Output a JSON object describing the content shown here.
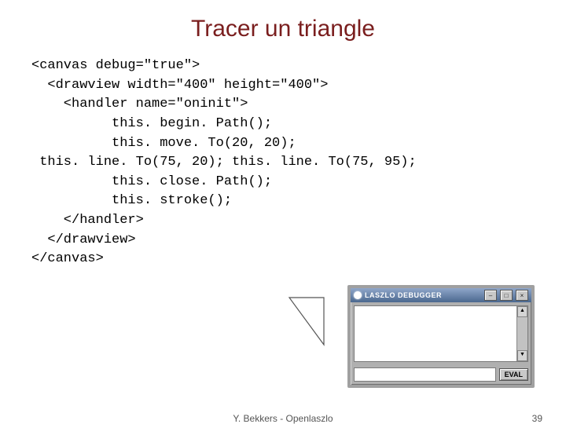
{
  "title": "Tracer un triangle",
  "code": {
    "l1": "<canvas debug=\"true\">",
    "l2": "  <drawview width=\"400\" height=\"400\">",
    "l3": "    <handler name=\"oninit\">",
    "l4": "          this. begin. Path();",
    "l5": "          this. move. To(20, 20);",
    "l6": " this. line. To(75, 20); this. line. To(75, 95);",
    "l7": "          this. close. Path();",
    "l8": "          this. stroke();",
    "l9": "    </handler>",
    "l10": "  </drawview>",
    "l11": "</canvas>"
  },
  "debugger": {
    "title": "LASZLO DEBUGGER",
    "eval": "EVAL"
  },
  "footer": {
    "center": "Y. Bekkers - Openlaszlo",
    "page": "39"
  }
}
